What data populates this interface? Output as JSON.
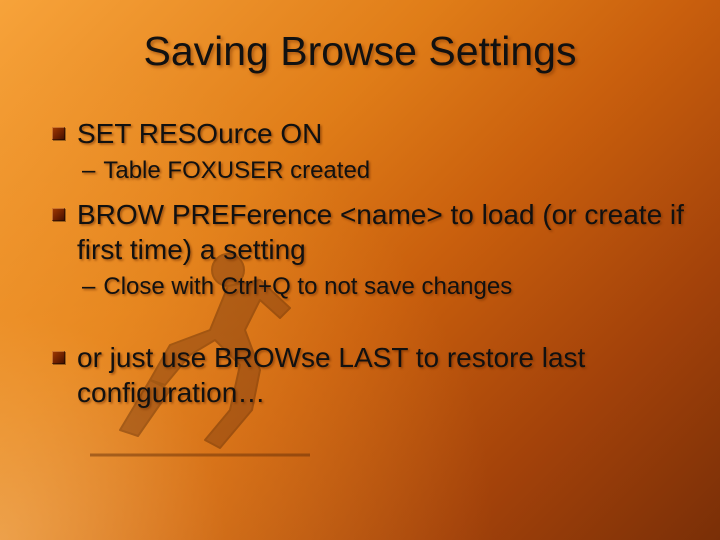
{
  "title": "Saving Browse Settings",
  "bullets": {
    "b1": "SET RESOurce ON",
    "b1_sub": "Table FOXUSER created",
    "b2": "BROW PREFerence <name> to load (or create if first time) a setting",
    "b2_sub": "Close with Ctrl+Q to not save changes",
    "b3": "or just use BROWse LAST to restore last configuration…"
  }
}
